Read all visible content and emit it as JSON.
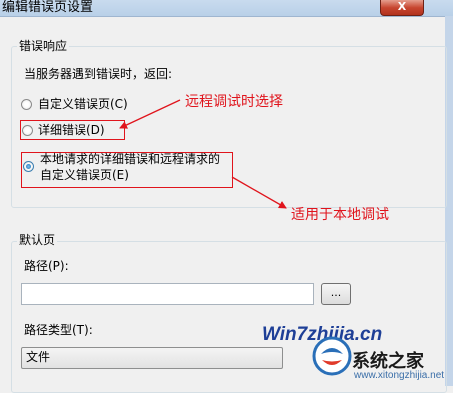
{
  "window": {
    "title": "编辑错误页设置",
    "close_glyph": "X"
  },
  "error_response": {
    "group_label": "错误响应",
    "prompt": "当服务器遇到错误时，返回:",
    "options": [
      {
        "label": "自定义错误页(C)",
        "checked": false
      },
      {
        "label": "详细错误(D)",
        "checked": false
      },
      {
        "label_line1": "本地请求的详细错误和远程请求的",
        "label_line2": "自定义错误页(E)",
        "checked": true
      }
    ]
  },
  "annotations": {
    "remote": "远程调试时选择",
    "local": "适用于本地调试",
    "color": "#e0141c"
  },
  "default_page": {
    "group_label": "默认页",
    "path_label": "路径(P):",
    "path_value": "",
    "browse_label": "...",
    "path_type_label": "路径类型(T):",
    "path_type_value": "文件"
  },
  "watermark": {
    "url": "Win7zhijia.cn",
    "site_name": "系统之家",
    "site_url": "www.xitongzhijia.net"
  }
}
